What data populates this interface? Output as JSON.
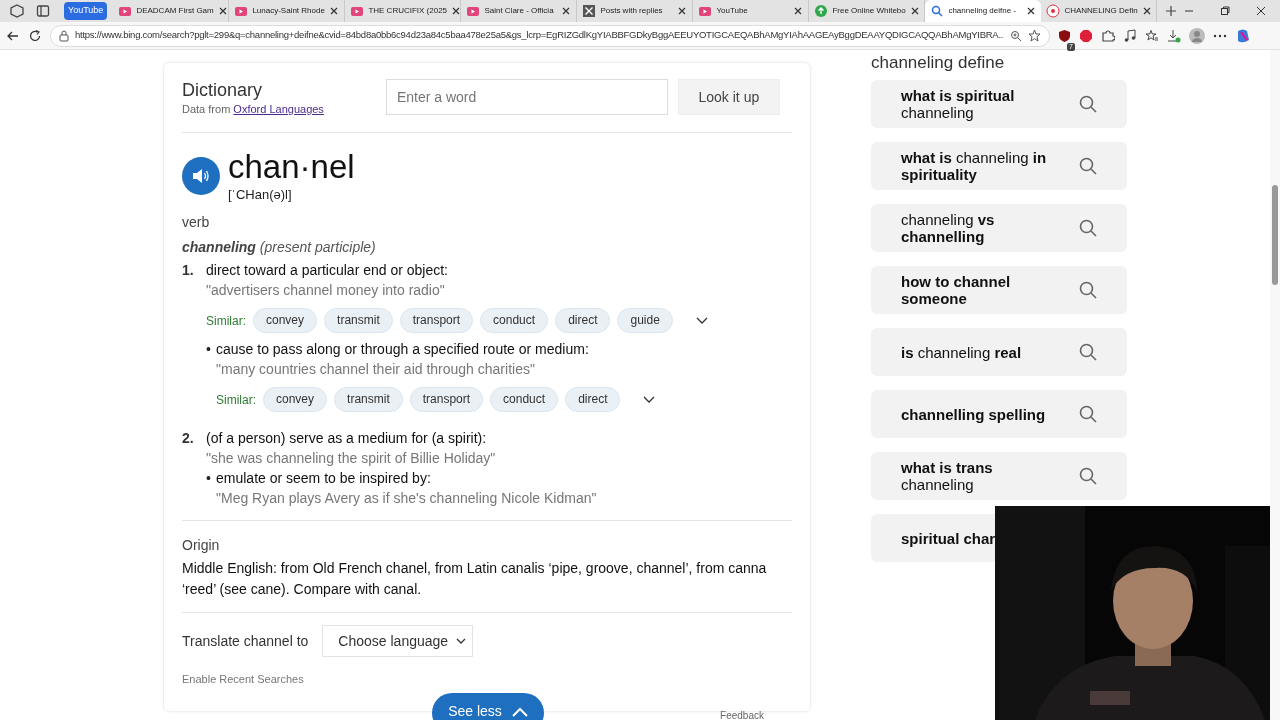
{
  "browser": {
    "tab_group": "YouTube",
    "tabs": [
      {
        "label": "DEADCAM First Gam",
        "kind": "video",
        "selected": false
      },
      {
        "label": "Lunacy-Saint Rhode",
        "kind": "video",
        "selected": false
      },
      {
        "label": "THE CRUCIFIX (2025",
        "kind": "video",
        "selected": false
      },
      {
        "label": "Saint Clare - Officia",
        "kind": "video",
        "selected": false
      },
      {
        "label": "Posts with replies",
        "kind": "x",
        "selected": false
      },
      {
        "label": "YouTube",
        "kind": "video",
        "selected": false
      },
      {
        "label": "Free Online Whitebo",
        "kind": "board",
        "selected": false
      },
      {
        "label": "channeling deifne -",
        "kind": "search",
        "selected": true
      },
      {
        "label": "CHANNELING Defin",
        "kind": "site",
        "selected": false
      }
    ],
    "url": "https://www.bing.com/search?pglt=299&q=channeling+deifne&cvid=84bd8a0bb6c94d23a84c5baa478e25a5&gs_lcrp=EgRIZGdlKgYIABBFGDkyBggAEEUYOTIGCAEQABhAMgYIAhAAGEAyBggDEAAYQDIGCAQQABhAMgYIBRA...",
    "extension_badge": "7"
  },
  "dictionary": {
    "title": "Dictionary",
    "source_prefix": "Data from",
    "source_link": "Oxford Languages",
    "search_placeholder": "Enter a word",
    "lookup_button": "Look it up",
    "word": "chan·nel",
    "pronunciation": "[ˈCHan(ə)l]",
    "part_of_speech": "verb",
    "inflection": "**channeling** (present participle)",
    "senses": [
      {
        "number": "1.",
        "definition": "direct toward a particular end or object:",
        "example": "\"advertisers channel money into radio\"",
        "similar_label": "Similar:",
        "similar": [
          "convey",
          "transmit",
          "transport",
          "conduct",
          "direct",
          "guide"
        ],
        "subsenses": [
          {
            "bullet": "•",
            "definition": "cause to pass along or through a specified route or medium:",
            "example": "\"many countries channel their aid through charities\"",
            "similar_label": "Similar:",
            "similar": [
              "convey",
              "transmit",
              "transport",
              "conduct",
              "direct"
            ]
          }
        ]
      },
      {
        "number": "2.",
        "definition": "(of a person) serve as a medium for (a spirit):",
        "example": "\"she was channeling the spirit of Billie Holiday\"",
        "subsenses": [
          {
            "bullet": "•",
            "definition": "emulate or seem to be inspired by:",
            "example": "\"Meg Ryan plays Avery as if she's channeling Nicole Kidman\""
          }
        ]
      }
    ],
    "origin_label": "Origin",
    "origin_text": "Middle English: from Old French chanel, from Latin canalis ‘pipe, groove, channel’, from canna ‘reed’ (see cane). Compare with canal.",
    "translate_label": "Translate channel to",
    "language_select": "Choose language",
    "enable_recent": "Enable Recent Searches",
    "see_less": "See less",
    "feedback": "Feedback"
  },
  "related": {
    "heading": "channeling define",
    "items": [
      "**what is spiritual** channeling",
      "**what is** channeling **in spirituality**",
      "channeling **vs channelling**",
      "**how to channel someone**",
      "**is** channeling **real**",
      "**channelling spelling**",
      "**what is trans** channeling",
      "**spiritual char**"
    ]
  }
}
